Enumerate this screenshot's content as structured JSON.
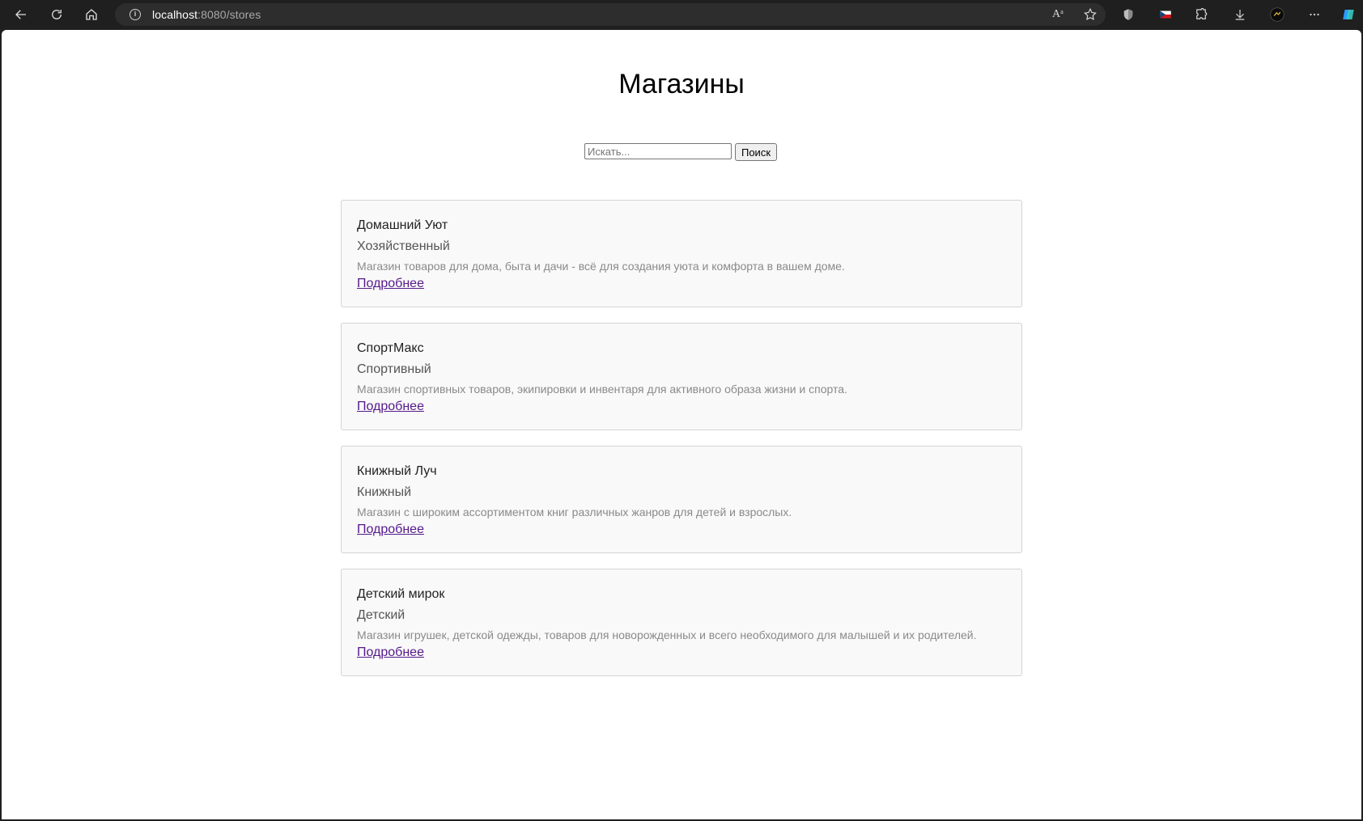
{
  "browser": {
    "url_host": "localhost",
    "url_path": ":8080/stores",
    "read_aloud_label": "Aᵃ"
  },
  "page": {
    "title": "Магазины",
    "search": {
      "placeholder": "Искать...",
      "value": "",
      "button_label": "Поиск"
    }
  },
  "stores": [
    {
      "name": "Домашний Уют",
      "type": "Хозяйственный",
      "description": "Магазин товаров для дома, быта и дачи - всё для создания уюта и комфорта в вашем доме.",
      "link_label": "Подробнее"
    },
    {
      "name": "СпортМакс",
      "type": "Спортивный",
      "description": "Магазин спортивных товаров, экипировки и инвентаря для активного образа жизни и спорта.",
      "link_label": "Подробнее"
    },
    {
      "name": "Книжный Луч",
      "type": "Книжный",
      "description": "Магазин с широким ассортиментом книг различных жанров для детей и взрослых.",
      "link_label": "Подробнее"
    },
    {
      "name": "Детский мирок",
      "type": "Детский",
      "description": "Магазин игрушек, детской одежды, товаров для новорожденных и всего необходимого для малышей и их родителей.",
      "link_label": "Подробнее"
    }
  ],
  "colors": {
    "chrome_bg": "#1f1f1f",
    "card_bg": "#f9f9f9",
    "link_visited": "#551a8b",
    "description_text": "#8a8a8a"
  }
}
